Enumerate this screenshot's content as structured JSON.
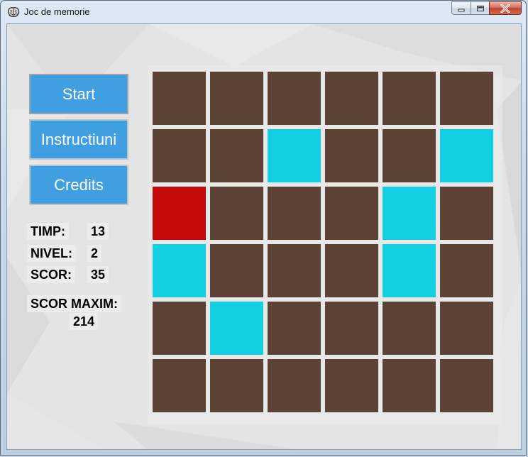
{
  "window": {
    "title": "Joc de memorie",
    "app_icon": "brain-icon",
    "controls": [
      "minimize-icon",
      "maximize-icon",
      "close-icon"
    ]
  },
  "menu": {
    "start_label": "Start",
    "instructions_label": "Instructiuni",
    "credits_label": "Credits"
  },
  "stats": {
    "time_label": "TIMP:",
    "time_value": "13",
    "level_label": "NIVEL:",
    "level_value": "2",
    "score_label": "SCOR:",
    "score_value": "35",
    "max_score_label": "SCOR MAXIM:",
    "max_score_value": "214"
  },
  "colors": {
    "hidden": "#5d4336",
    "revealed": "#12cfe1",
    "wrong": "#c40a0a",
    "button": "#3f9fe0"
  },
  "grid": {
    "rows": 6,
    "cols": 6,
    "cells": [
      [
        "hidden",
        "hidden",
        "hidden",
        "hidden",
        "hidden",
        "hidden"
      ],
      [
        "hidden",
        "hidden",
        "revealed",
        "hidden",
        "hidden",
        "revealed"
      ],
      [
        "wrong",
        "hidden",
        "hidden",
        "hidden",
        "revealed",
        "hidden"
      ],
      [
        "revealed",
        "hidden",
        "hidden",
        "hidden",
        "revealed",
        "hidden"
      ],
      [
        "hidden",
        "revealed",
        "hidden",
        "hidden",
        "hidden",
        "hidden"
      ],
      [
        "hidden",
        "hidden",
        "hidden",
        "hidden",
        "hidden",
        "hidden"
      ]
    ]
  }
}
